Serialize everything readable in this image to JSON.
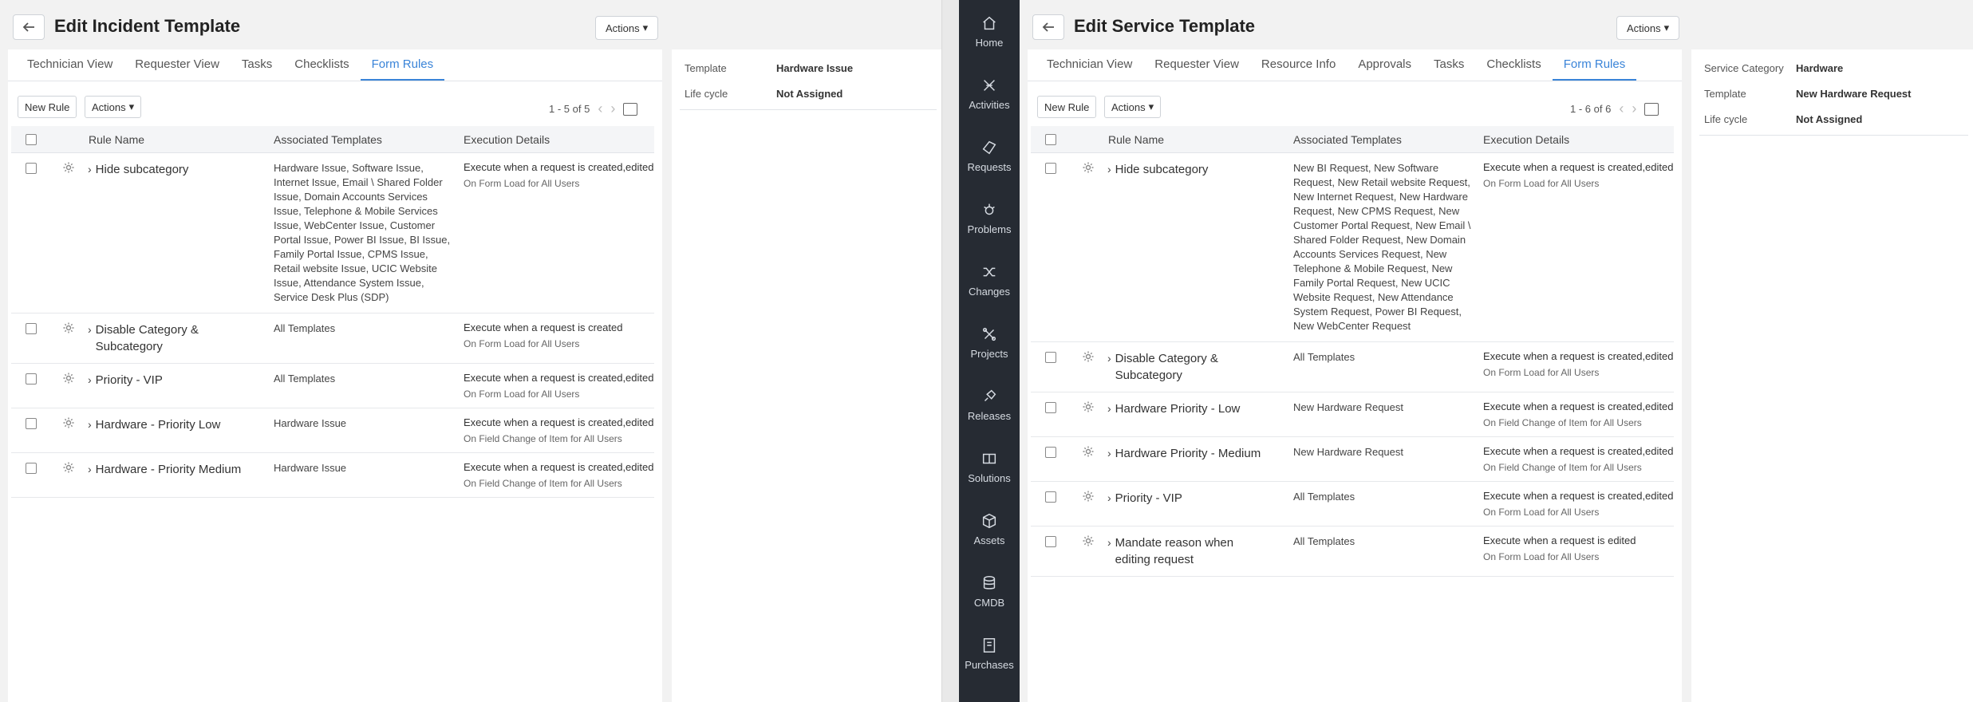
{
  "nav": [
    {
      "label": "Home",
      "icon": "home-icon"
    },
    {
      "label": "Activities",
      "icon": "activities-icon"
    },
    {
      "label": "Requests",
      "icon": "requests-icon"
    },
    {
      "label": "Problems",
      "icon": "problems-icon"
    },
    {
      "label": "Changes",
      "icon": "changes-icon"
    },
    {
      "label": "Projects",
      "icon": "projects-icon"
    },
    {
      "label": "Releases",
      "icon": "releases-icon"
    },
    {
      "label": "Solutions",
      "icon": "solutions-icon"
    },
    {
      "label": "Assets",
      "icon": "assets-icon"
    },
    {
      "label": "CMDB",
      "icon": "cmdb-icon"
    },
    {
      "label": "Purchases",
      "icon": "purchases-icon"
    }
  ],
  "left": {
    "title": "Edit Incident Template",
    "actions_label": "Actions",
    "tabs": [
      "Technician View",
      "Requester View",
      "Tasks",
      "Checklists",
      "Form Rules"
    ],
    "active_tab": "Form Rules",
    "new_rule_label": "New Rule",
    "toolbar_actions_label": "Actions",
    "pager": "1 - 5 of 5",
    "columns": {
      "name": "Rule Name",
      "assoc": "Associated Templates",
      "exec": "Execution Details"
    },
    "rows": [
      {
        "name": "Hide subcategory",
        "assoc": "Hardware Issue, Software Issue, Internet Issue, Email \\ Shared Folder Issue, Domain Accounts Services Issue, Telephone & Mobile Services Issue, WebCenter Issue, Customer Portal Issue, Power BI Issue, BI Issue, Family Portal Issue, CPMS Issue, Retail website Issue, UCIC Website Issue, Attendance System Issue, Service Desk Plus (SDP)",
        "exec1": "Execute when a request is created,edited",
        "exec2": "On Form Load for All Users"
      },
      {
        "name": "Disable Category & Subcategory",
        "assoc": "All Templates",
        "exec1": "Execute when a request is created",
        "exec2": "On Form Load for All Users"
      },
      {
        "name": "Priority - VIP",
        "assoc": "All Templates",
        "exec1": "Execute when a request is created,edited",
        "exec2": "On Form Load for All Users"
      },
      {
        "name": "Hardware - Priority Low",
        "assoc": "Hardware Issue",
        "exec1": "Execute when a request is created,edited",
        "exec2": "On Field Change of Item for All Users"
      },
      {
        "name": "Hardware - Priority Medium",
        "assoc": "Hardware Issue",
        "exec1": "Execute when a request is created,edited",
        "exec2": "On Field Change of Item for All Users"
      }
    ],
    "side": [
      {
        "label": "Template",
        "value": "Hardware Issue"
      },
      {
        "label": "Life cycle",
        "value": "Not Assigned"
      }
    ]
  },
  "right": {
    "title": "Edit Service Template",
    "actions_label": "Actions",
    "tabs": [
      "Technician View",
      "Requester View",
      "Resource Info",
      "Approvals",
      "Tasks",
      "Checklists",
      "Form Rules"
    ],
    "active_tab": "Form Rules",
    "new_rule_label": "New Rule",
    "toolbar_actions_label": "Actions",
    "pager": "1 - 6 of 6",
    "columns": {
      "name": "Rule Name",
      "assoc": "Associated Templates",
      "exec": "Execution Details"
    },
    "rows": [
      {
        "name": "Hide subcategory",
        "assoc": "New BI Request, New Software Request, New Retail website Request, New Internet Request, New Hardware Request, New CPMS Request, New Customer Portal Request, New Email \\ Shared Folder Request, New Domain Accounts Services Request, New Telephone & Mobile Request, New Family Portal Request, New UCIC Website Request, New Attendance System Request, Power BI Request, New WebCenter Request",
        "exec1": "Execute when a request is created,edited",
        "exec2": "On Form Load for All Users"
      },
      {
        "name": "Disable Category & Subcategory",
        "assoc": "All Templates",
        "exec1": "Execute when a request is created,edited",
        "exec2": "On Form Load for All Users"
      },
      {
        "name": "Hardware Priority - Low",
        "assoc": "New Hardware Request",
        "exec1": "Execute when a request is created,edited",
        "exec2": "On Field Change of Item for All Users"
      },
      {
        "name": "Hardware Priority - Medium",
        "assoc": "New Hardware Request",
        "exec1": "Execute when a request is created,edited",
        "exec2": "On Field Change of Item for All Users"
      },
      {
        "name": "Priority - VIP",
        "assoc": "All Templates",
        "exec1": "Execute when a request is created,edited",
        "exec2": "On Form Load for All Users"
      },
      {
        "name": "Mandate reason when editing request",
        "assoc": "All Templates",
        "exec1": "Execute when a request is edited",
        "exec2": "On Form Load for All Users"
      }
    ],
    "side": [
      {
        "label": "Service Category",
        "value": "Hardware"
      },
      {
        "label": "Template",
        "value": "New Hardware Request"
      },
      {
        "label": "Life cycle",
        "value": "Not Assigned"
      }
    ]
  },
  "colors": {
    "accent": "#3a84d8",
    "nav_bg": "#262b33"
  }
}
